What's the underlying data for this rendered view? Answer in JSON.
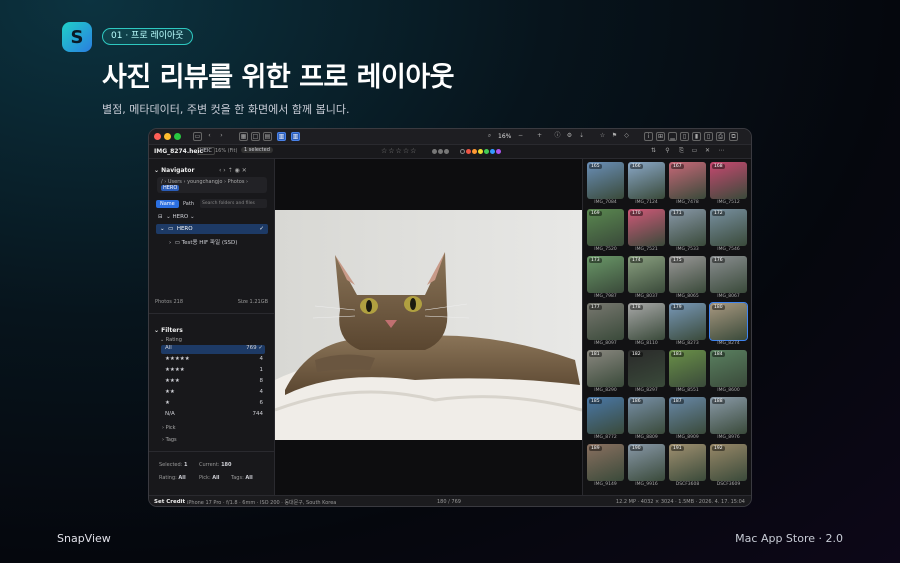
{
  "hero": {
    "badge": "01 · 프로 레이아웃",
    "title": "사진 리뷰를 위한 프로 레이아웃",
    "subtitle": "별점, 메타데이터, 주변 컷을 한 화면에서 함께 봅니다."
  },
  "footer": {
    "brand": "SnapView",
    "store": "Mac App Store · 2.0"
  },
  "toolbar": {
    "zoom": "16%"
  },
  "infobar": {
    "filename": "IMG_8274.heic",
    "format": "HEIC",
    "zoom_fit": "16% (Fit)",
    "selected": "1 selected",
    "stars": "☆☆☆☆☆"
  },
  "navigator": {
    "title": "Navigator",
    "crumbs": [
      "/",
      "Users",
      "youngchangjo",
      "Photos",
      "HERO"
    ],
    "tab_name": "Name",
    "tab_path": "Path",
    "search_placeholder": "Search folders and files",
    "root": "HERO",
    "folder": "HERO",
    "subfolder": "Test용 HIF 파일 (SSD)",
    "photos": "Photos 218",
    "size": "Size 1.21GB"
  },
  "filters": {
    "title": "Filters",
    "rating_label": "Rating",
    "rows": [
      {
        "label": "All",
        "count": "769"
      },
      {
        "label": "★★★★★",
        "count": "4"
      },
      {
        "label": "★★★★",
        "count": "1"
      },
      {
        "label": "★★★",
        "count": "8"
      },
      {
        "label": "★★",
        "count": "4"
      },
      {
        "label": "★",
        "count": "6"
      },
      {
        "label": "N/A",
        "count": "744"
      }
    ],
    "pick": "Pick",
    "tags": "Tags"
  },
  "summary": {
    "selected_label": "Selected:",
    "selected": "1",
    "current_label": "Current:",
    "current": "180",
    "rating_label": "Rating:",
    "rating": "All",
    "pick_label": "Pick:",
    "pick": "All",
    "tags_label": "Tags:",
    "tags": "All"
  },
  "status": {
    "credit": "Set Credit",
    "exif": "iPhone 17 Pro · f/1.8 · 6mm · ISO 200 · 동대문구, South Korea",
    "position": "180 / 769",
    "meta": "12.2 MP · 4032 × 3024 · 1.5MB · 2026. 4. 17. 15:04"
  },
  "thumbs": [
    {
      "n": "165",
      "name": "IMG_7084",
      "c": "#6a8fb8"
    },
    {
      "n": "166",
      "name": "IMG_7124",
      "c": "#8aa8c8"
    },
    {
      "n": "167",
      "name": "IMG_7478",
      "c": "#c86878"
    },
    {
      "n": "168",
      "name": "IMG_7512",
      "c": "#c84870"
    },
    {
      "n": "169",
      "name": "IMG_7520",
      "c": "#5a8850"
    },
    {
      "n": "170",
      "name": "IMG_7521",
      "c": "#d05878"
    },
    {
      "n": "171",
      "name": "IMG_7533",
      "c": "#8898a8"
    },
    {
      "n": "172",
      "name": "IMG_7546",
      "c": "#7890a0"
    },
    {
      "n": "173",
      "name": "IMG_7987",
      "c": "#6a9868"
    },
    {
      "n": "174",
      "name": "IMG_8037",
      "c": "#8aa080"
    },
    {
      "n": "175",
      "name": "IMG_8065",
      "c": "#9a9898"
    },
    {
      "n": "176",
      "name": "IMG_8067",
      "c": "#8a8e90"
    },
    {
      "n": "177",
      "name": "IMG_8097",
      "c": "#787870"
    },
    {
      "n": "178",
      "name": "IMG_8110",
      "c": "#a8a8a8"
    },
    {
      "n": "179",
      "name": "IMG_8273",
      "c": "#7898b8"
    },
    {
      "n": "180",
      "name": "IMG_8274",
      "c": "#a89880"
    },
    {
      "n": "181",
      "name": "IMG_8290",
      "c": "#8a8880"
    },
    {
      "n": "182",
      "name": "IMG_8297",
      "c": "#2a2a2a"
    },
    {
      "n": "183",
      "name": "IMG_8551",
      "c": "#6a9048"
    },
    {
      "n": "184",
      "name": "IMG_8600",
      "c": "#5a8060"
    },
    {
      "n": "185",
      "name": "IMG_8772",
      "c": "#4a78a8"
    },
    {
      "n": "186",
      "name": "IMG_8809",
      "c": "#7890a8"
    },
    {
      "n": "187",
      "name": "IMG_8909",
      "c": "#6888a8"
    },
    {
      "n": "188",
      "name": "IMG_8976",
      "c": "#8a9aa8"
    },
    {
      "n": "189",
      "name": "IMG_9149",
      "c": "#8a7060"
    },
    {
      "n": "190",
      "name": "IMG_9916",
      "c": "#8898a8"
    },
    {
      "n": "191",
      "name": "DSCF3608",
      "c": "#a09070"
    },
    {
      "n": "192",
      "name": "DSCF3609",
      "c": "#988868"
    }
  ]
}
